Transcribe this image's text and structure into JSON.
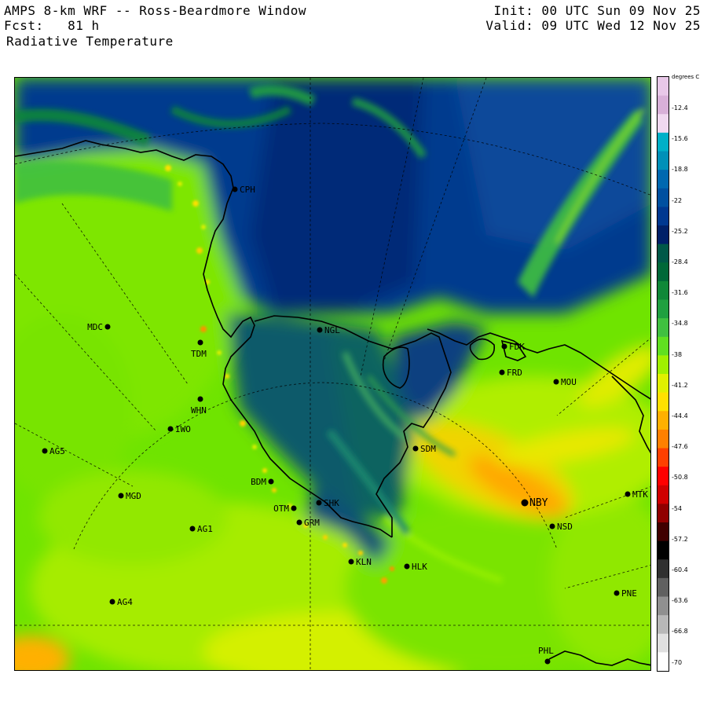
{
  "header": {
    "line1_left": "AMPS 8-km WRF -- Ross-Beardmore Window",
    "line2_left": "Fcst:   81 h",
    "line1_right": "Init: 00 UTC Sun 09 Nov 25",
    "line2_right": "Valid: 09 UTC Wed 12 Nov 25",
    "field": "Radiative Temperature"
  },
  "colorbar": {
    "unit": "degrees C",
    "ticks": [
      "-12.4",
      "-15.6",
      "-18.8",
      "-22",
      "-25.2",
      "-28.4",
      "-31.6",
      "-34.8",
      "-38",
      "-41.2",
      "-44.4",
      "-47.6",
      "-50.8",
      "-54",
      "-57.2",
      "-60.4",
      "-63.6",
      "-66.8",
      "-70"
    ],
    "colors": [
      "#e8c8e8",
      "#d8b0d8",
      "#f0d8f0",
      "#00b0c8",
      "#0090b8",
      "#0068b0",
      "#0050a0",
      "#003890",
      "#002068",
      "#005848",
      "#006838",
      "#108838",
      "#20a040",
      "#40c040",
      "#60e020",
      "#a0f000",
      "#e0f000",
      "#ffe000",
      "#ffb000",
      "#ff8000",
      "#ff4000",
      "#ff0000",
      "#d00000",
      "#900000",
      "#400000",
      "#000000",
      "#303030",
      "#606060",
      "#909090",
      "#b8b8b8",
      "#e0e0e0",
      "#ffffff"
    ]
  },
  "stations": [
    {
      "id": "CPH",
      "label": "CPH"
    },
    {
      "id": "MDC",
      "label": "MDC"
    },
    {
      "id": "TDM",
      "label": "TDM"
    },
    {
      "id": "NGL",
      "label": "NGL"
    },
    {
      "id": "FDK",
      "label": "FDK"
    },
    {
      "id": "FRD",
      "label": "FRD"
    },
    {
      "id": "MOU",
      "label": "MOU"
    },
    {
      "id": "WHN",
      "label": "WHN"
    },
    {
      "id": "IWO",
      "label": "IWO"
    },
    {
      "id": "AG5",
      "label": "AG5"
    },
    {
      "id": "SDM",
      "label": "SDM"
    },
    {
      "id": "BDM",
      "label": "BDM"
    },
    {
      "id": "MGD",
      "label": "MGD"
    },
    {
      "id": "SHK",
      "label": "SHK"
    },
    {
      "id": "OTM",
      "label": "OTM"
    },
    {
      "id": "GRM",
      "label": "GRM"
    },
    {
      "id": "NBY",
      "label": "NBY"
    },
    {
      "id": "MTK",
      "label": "MTK"
    },
    {
      "id": "AG1",
      "label": "AG1"
    },
    {
      "id": "NSD",
      "label": "NSD"
    },
    {
      "id": "KLN",
      "label": "KLN"
    },
    {
      "id": "HLK",
      "label": "HLK"
    },
    {
      "id": "AG4",
      "label": "AG4"
    },
    {
      "id": "PNE",
      "label": "PNE"
    },
    {
      "id": "PHL",
      "label": "PHL"
    }
  ]
}
